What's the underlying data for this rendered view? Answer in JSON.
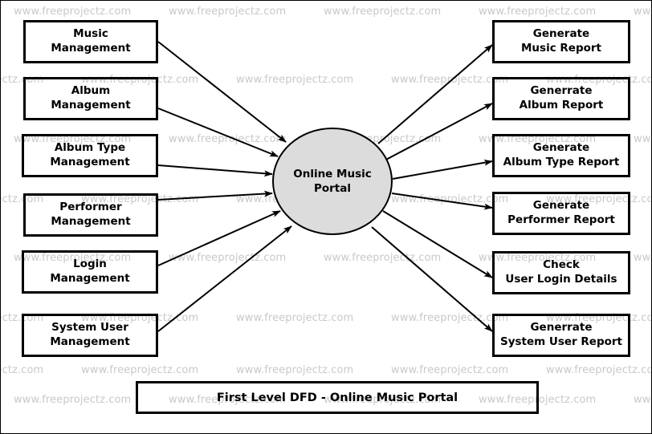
{
  "diagram": {
    "title": "First Level DFD - Online Music Portal",
    "watermark_text": "www.freeprojectz.com",
    "colors": {
      "process_fill": "#dcdcdc",
      "stroke": "#000000",
      "watermark": "#c9c9c9",
      "background": "#ffffff"
    },
    "process": {
      "name": "Online Music Portal",
      "line1": "Online",
      "line2": "Music",
      "line3": "Portal"
    },
    "inputs": [
      {
        "line1": "Music",
        "line2": "Management"
      },
      {
        "line1": "Album",
        "line2": "Management"
      },
      {
        "line1": "Album Type",
        "line2": "Management"
      },
      {
        "line1": "Performer",
        "line2": "Management"
      },
      {
        "line1": "Login",
        "line2": "Management"
      },
      {
        "line1": "System User",
        "line2": "Management"
      }
    ],
    "outputs": [
      {
        "line1": "Generate",
        "line2": "Music Report"
      },
      {
        "line1": "Generrate",
        "line2": "Album Report"
      },
      {
        "line1": "Generate",
        "line2": "Album Type Report"
      },
      {
        "line1": "Generate",
        "line2": "Performer Report"
      },
      {
        "line1": "Check",
        "line2": "User Login Details"
      },
      {
        "line1": "Generrate",
        "line2": "System User Report"
      }
    ],
    "caption": "First Level DFD - Online Music Portal"
  }
}
